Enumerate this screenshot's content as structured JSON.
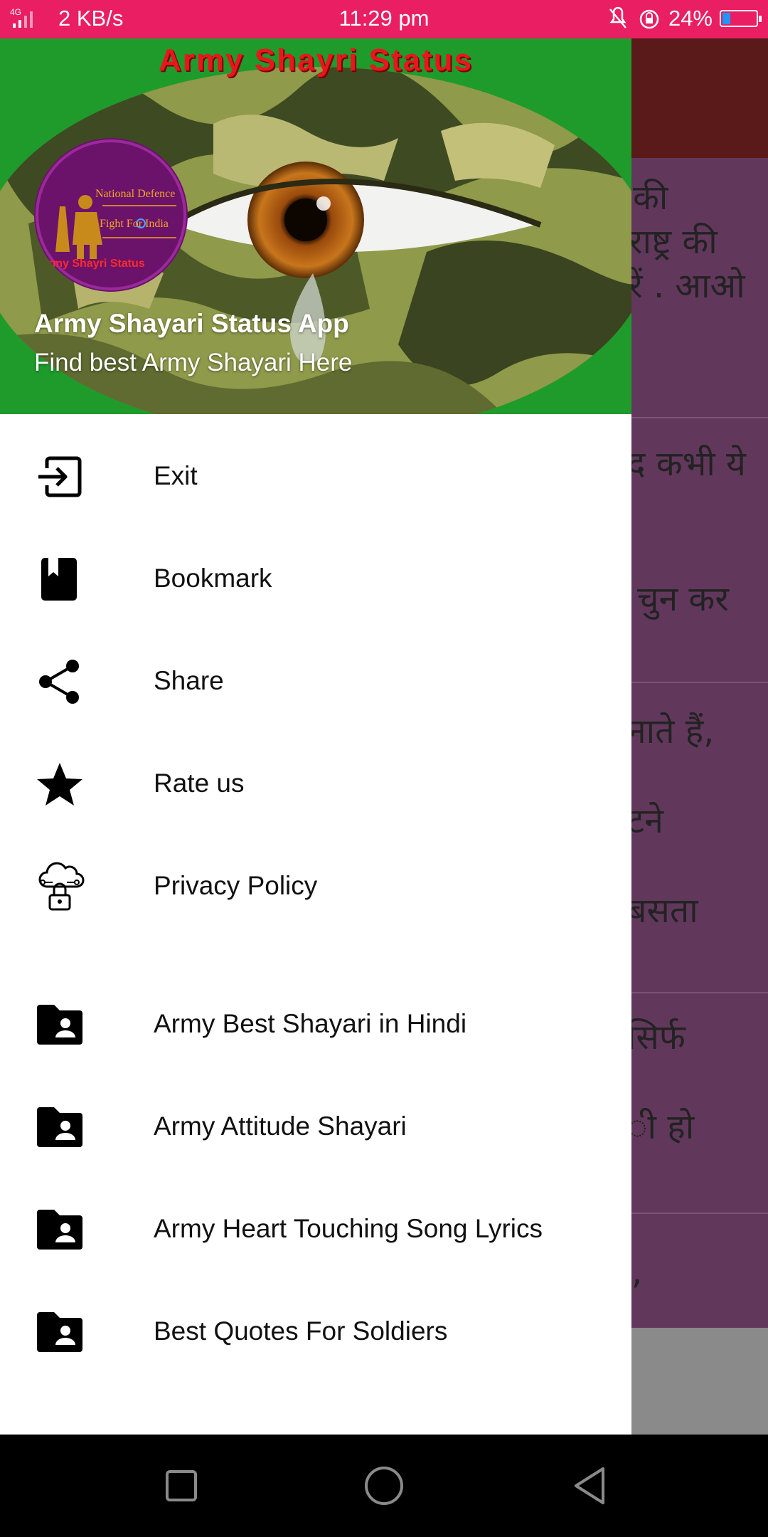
{
  "status_bar": {
    "network": "4G",
    "speed": "2 KB/s",
    "time": "11:29 pm",
    "battery": "24%",
    "battery_level": 0.24,
    "color": "#e91e63"
  },
  "background_content": {
    "cards": [
      {
        "lines": [
          "की",
          "राष्ट्र की",
          "रें . आओ"
        ]
      },
      {
        "lines": [
          "द कभी ये",
          "",
          "चुन कर"
        ]
      },
      {
        "lines": [
          "नाते हैं,",
          "टने",
          "बसता"
        ]
      },
      {
        "lines": [
          "सिर्फ",
          "ी हो"
        ]
      },
      {
        "lines": [
          ","
        ]
      }
    ]
  },
  "drawer": {
    "header": {
      "banner_title": "Army Shayri Status",
      "logo_text": {
        "line1": "National Defence",
        "line2": "Fight For India",
        "line3": "Army Shayri Status"
      },
      "app_name": "Army Shayari Status App",
      "subtitle": "Find best Army Shayari Here"
    },
    "menu": [
      {
        "label": "Exit",
        "icon": "exit-icon"
      },
      {
        "label": "Bookmark",
        "icon": "bookmark-icon"
      },
      {
        "label": "Share",
        "icon": "share-icon"
      },
      {
        "label": "Rate us",
        "icon": "star-icon"
      },
      {
        "label": "Privacy Policy",
        "icon": "cloud-lock-icon"
      },
      {
        "label": "Army Best Shayari in Hindi",
        "icon": "folder-user-icon"
      },
      {
        "label": "Army Attitude Shayari",
        "icon": "folder-user-icon"
      },
      {
        "label": "Army Heart Touching Song Lyrics",
        "icon": "folder-user-icon"
      },
      {
        "label": "Best Quotes For Soldiers",
        "icon": "folder-user-icon"
      }
    ]
  },
  "nav_bar": {
    "buttons": [
      "recents",
      "home",
      "back"
    ]
  }
}
